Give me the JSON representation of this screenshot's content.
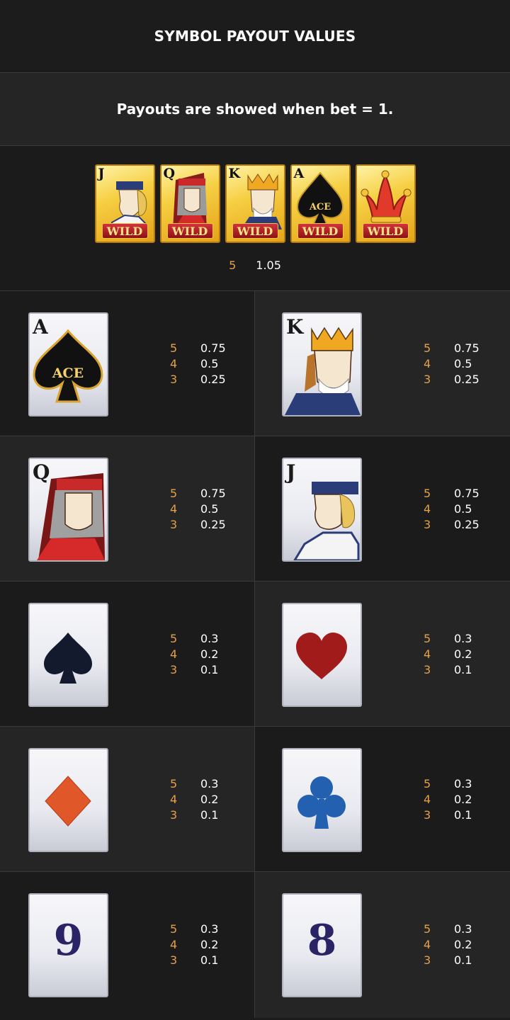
{
  "header": {
    "title": "SYMBOL PAYOUT VALUES"
  },
  "note": "Payouts are showed when bet = 1.",
  "wild": {
    "cards": [
      {
        "rank": "J",
        "label": "WILD",
        "icon": "jack-face-icon"
      },
      {
        "rank": "Q",
        "label": "WILD",
        "icon": "queen-face-icon"
      },
      {
        "rank": "K",
        "label": "WILD",
        "icon": "king-face-icon"
      },
      {
        "rank": "A",
        "label": "WILD",
        "icon": "ace-spade-icon",
        "badge": "ACE"
      },
      {
        "rank": "",
        "label": "WILD",
        "icon": "jester-hat-icon"
      }
    ],
    "payout": {
      "count": "5",
      "value": "1.05"
    }
  },
  "symbols": [
    {
      "id": "ace",
      "rank": "A",
      "badge": "ACE",
      "icon": "ace-spade-icon",
      "pays": [
        {
          "count": "5",
          "value": "0.75"
        },
        {
          "count": "4",
          "value": "0.5"
        },
        {
          "count": "3",
          "value": "0.25"
        }
      ]
    },
    {
      "id": "king",
      "rank": "K",
      "icon": "king-face-icon",
      "pays": [
        {
          "count": "5",
          "value": "0.75"
        },
        {
          "count": "4",
          "value": "0.5"
        },
        {
          "count": "3",
          "value": "0.25"
        }
      ]
    },
    {
      "id": "queen",
      "rank": "Q",
      "icon": "queen-face-icon",
      "pays": [
        {
          "count": "5",
          "value": "0.75"
        },
        {
          "count": "4",
          "value": "0.5"
        },
        {
          "count": "3",
          "value": "0.25"
        }
      ]
    },
    {
      "id": "jack",
      "rank": "J",
      "icon": "jack-face-icon",
      "pays": [
        {
          "count": "5",
          "value": "0.75"
        },
        {
          "count": "4",
          "value": "0.5"
        },
        {
          "count": "3",
          "value": "0.25"
        }
      ]
    },
    {
      "id": "spade",
      "icon": "spade-icon",
      "pays": [
        {
          "count": "5",
          "value": "0.3"
        },
        {
          "count": "4",
          "value": "0.2"
        },
        {
          "count": "3",
          "value": "0.1"
        }
      ]
    },
    {
      "id": "heart",
      "icon": "heart-icon",
      "pays": [
        {
          "count": "5",
          "value": "0.3"
        },
        {
          "count": "4",
          "value": "0.2"
        },
        {
          "count": "3",
          "value": "0.1"
        }
      ]
    },
    {
      "id": "diamond",
      "icon": "diamond-icon",
      "pays": [
        {
          "count": "5",
          "value": "0.3"
        },
        {
          "count": "4",
          "value": "0.2"
        },
        {
          "count": "3",
          "value": "0.1"
        }
      ]
    },
    {
      "id": "club",
      "icon": "club-icon",
      "pays": [
        {
          "count": "5",
          "value": "0.3"
        },
        {
          "count": "4",
          "value": "0.2"
        },
        {
          "count": "3",
          "value": "0.1"
        }
      ]
    },
    {
      "id": "nine",
      "number": "9",
      "icon": "nine-icon",
      "pays": [
        {
          "count": "5",
          "value": "0.3"
        },
        {
          "count": "4",
          "value": "0.2"
        },
        {
          "count": "3",
          "value": "0.1"
        }
      ]
    },
    {
      "id": "eight",
      "number": "8",
      "icon": "eight-icon",
      "pays": [
        {
          "count": "5",
          "value": "0.3"
        },
        {
          "count": "4",
          "value": "0.2"
        },
        {
          "count": "3",
          "value": "0.1"
        }
      ]
    }
  ],
  "colors": {
    "count": "#e5a049",
    "value": "#ffffff",
    "bg_dark": "#1b1b1b",
    "bg_light": "#252525"
  }
}
